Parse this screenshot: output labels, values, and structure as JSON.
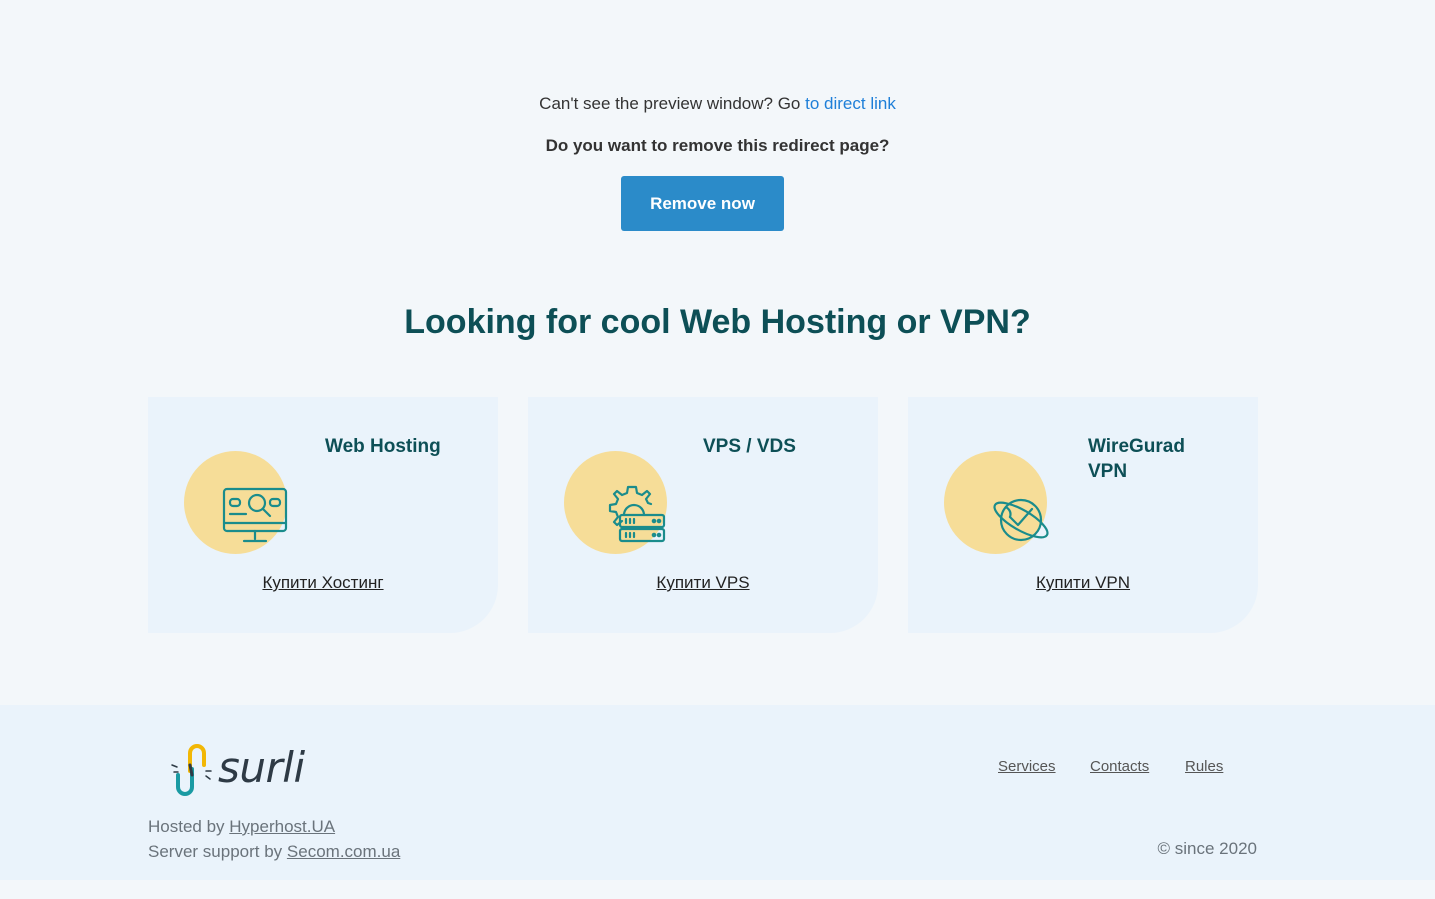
{
  "preview": {
    "text": "Can't see the preview window? Go ",
    "link": "to direct link"
  },
  "remove": {
    "question": "Do you want to remove this redirect page?",
    "button": "Remove now"
  },
  "headline": "Looking for cool Web Hosting or VPN?",
  "cards": [
    {
      "title": "Web Hosting",
      "buy": "Купити Хостинг",
      "icon": "monitor-search-icon"
    },
    {
      "title": "VPS / VDS",
      "buy": "Купити VPS",
      "icon": "server-gear-icon"
    },
    {
      "title": "WireGurad VPN",
      "buy": "Купити VPN",
      "icon": "globe-check-icon"
    }
  ],
  "footer": {
    "logo": "surli",
    "nav": [
      "Services",
      "Contacts",
      "Rules"
    ],
    "hosted_prefix": "Hosted by ",
    "hosted_link": "Hyperhost.UA",
    "support_prefix": "Server support by ",
    "support_link": "Secom.com.ua",
    "since": "© since 2020"
  },
  "colors": {
    "accent": "#2b8bc9",
    "heading": "#0d4f56",
    "circle": "#f6dd98",
    "icon": "#1a8c8c",
    "link": "#1e7fd8"
  }
}
